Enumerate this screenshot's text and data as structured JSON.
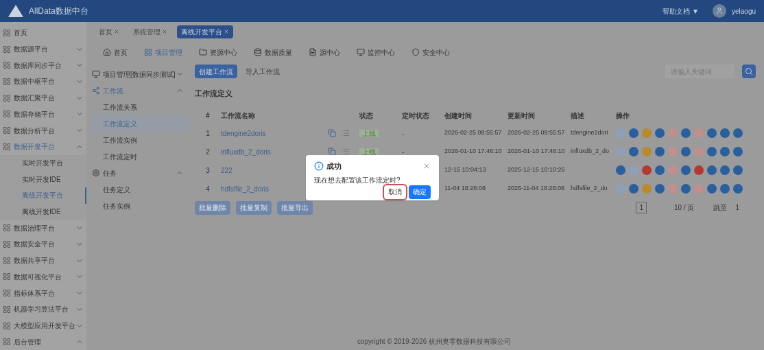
{
  "header": {
    "title": "AllData数据中台",
    "help": "帮助文档 ▼",
    "user": "yelaogu"
  },
  "sidebar": {
    "items": [
      {
        "label": "首页",
        "selected": false
      },
      {
        "label": "数据源平台",
        "expanded": false,
        "selected": false
      },
      {
        "label": "数据库同步平台",
        "expanded": false,
        "selected": false
      },
      {
        "label": "数据中枢平台",
        "expanded": false,
        "selected": false
      },
      {
        "label": "数据汇聚平台",
        "expanded": false,
        "selected": false
      },
      {
        "label": "数据存储平台",
        "expanded": false,
        "selected": false
      },
      {
        "label": "数据分析平台",
        "expanded": false,
        "selected": false
      },
      {
        "label": "数据开发平台",
        "expanded": true,
        "selected": true,
        "children": [
          {
            "label": "实时开发平台",
            "selected": false
          },
          {
            "label": "实时开发IDE",
            "selected": false
          },
          {
            "label": "离线开发平台",
            "selected": true
          },
          {
            "label": "离线开发IDE",
            "selected": false
          }
        ]
      },
      {
        "label": "数据治理平台",
        "expanded": false,
        "selected": false
      },
      {
        "label": "数据安全平台",
        "expanded": false,
        "selected": false
      },
      {
        "label": "数据共享平台",
        "expanded": false,
        "selected": false
      },
      {
        "label": "数据可视化平台",
        "expanded": false,
        "selected": false
      },
      {
        "label": "指标体系平台",
        "expanded": false,
        "selected": false
      },
      {
        "label": "机器学习算法平台",
        "expanded": false,
        "selected": false
      },
      {
        "label": "大模型应用开发平台",
        "expanded": false,
        "selected": false
      },
      {
        "label": "后台管理",
        "expanded": true,
        "selected": false
      }
    ]
  },
  "page_tabs": [
    {
      "label": "首页",
      "selected": false
    },
    {
      "label": "系统管理",
      "selected": false
    },
    {
      "label": "离线开发平台",
      "selected": true
    }
  ],
  "top_nav": [
    {
      "label": "首页",
      "selected": false
    },
    {
      "label": "项目管理",
      "selected": true
    },
    {
      "label": "资源中心",
      "selected": false
    },
    {
      "label": "数据质量",
      "selected": false
    },
    {
      "label": "源中心",
      "selected": false
    },
    {
      "label": "监控中心",
      "selected": false
    },
    {
      "label": "安全中心",
      "selected": false
    }
  ],
  "sub_menu": [
    {
      "label": "项目管理[数据同步测试]",
      "expanded": false
    },
    {
      "label": "工作流",
      "expanded": true,
      "children": [
        {
          "label": "工作流关系",
          "selected": false
        },
        {
          "label": "工作流定义",
          "selected": true
        },
        {
          "label": "工作流实例",
          "selected": false
        },
        {
          "label": "工作流定时",
          "selected": false
        }
      ]
    },
    {
      "label": "任务",
      "expanded": true,
      "children": [
        {
          "label": "任务定义",
          "selected": false
        },
        {
          "label": "任务实例",
          "selected": false
        }
      ]
    }
  ],
  "toolbar": {
    "create": "创建工作流",
    "import": "导入工作流",
    "search": {
      "placeholder": "请输入关键词"
    }
  },
  "section_title": "工作流定义",
  "table": {
    "columns": [
      "#",
      "工作流名称",
      "状态",
      "定时状态",
      "创建时间",
      "更新时间",
      "描述",
      "操作"
    ],
    "rows": [
      {
        "index": "1",
        "name": "tdengine2doris",
        "status": "上线",
        "schedule": "-",
        "created": "2026-02-25 09:55:57",
        "updated": "2026-02-25 09:55:57",
        "description": "tdengine2dori",
        "actions": [
          {
            "color": "#8ea1b9"
          },
          {
            "color": "#2a5f9e"
          },
          {
            "color": "#b98a2a"
          },
          {
            "color": "#2a5f9e"
          },
          {
            "color": "#c28f8f"
          },
          {
            "color": "#2a5f9e"
          },
          {
            "color": "#c28f8f"
          },
          {
            "color": "#2a5f9e"
          },
          {
            "color": "#2a5f9e"
          },
          {
            "color": "#2a5f9e"
          }
        ]
      },
      {
        "index": "2",
        "name": "influxdb_2_doris",
        "status": "上线",
        "schedule": "-",
        "created": "2026-01-10 17:48:10",
        "updated": "2026-01-10 17:48:10",
        "description": "influxdb_2_do",
        "actions": [
          {
            "color": "#8ea1b9"
          },
          {
            "color": "#2a5f9e"
          },
          {
            "color": "#b98a2a"
          },
          {
            "color": "#2a5f9e"
          },
          {
            "color": "#c28f8f"
          },
          {
            "color": "#2a5f9e"
          },
          {
            "color": "#c28f8f"
          },
          {
            "color": "#2a5f9e"
          },
          {
            "color": "#2a5f9e"
          },
          {
            "color": "#2a5f9e"
          }
        ]
      },
      {
        "index": "3",
        "name": "222",
        "created": "12-15 10:04:13",
        "updated": "2025-12-15 10:10:26",
        "actions": [
          {
            "color": "#2a5f9e"
          },
          {
            "color": "#8ea1b9"
          },
          {
            "color": "#b23a32"
          },
          {
            "color": "#2a5f9e"
          },
          {
            "color": "#c28f8f"
          },
          {
            "color": "#2a5f9e"
          },
          {
            "color": "#b23a32"
          },
          {
            "color": "#2a5f9e"
          },
          {
            "color": "#2a5f9e"
          },
          {
            "color": "#2a5f9e"
          }
        ]
      },
      {
        "index": "4",
        "name": "hdfsfile_2_doris",
        "created": "11-04 18:28:08",
        "updated": "2025-11-04 18:28:08",
        "description": "hdfsfile_2_do",
        "actions": [
          {
            "color": "#8ea1b9"
          },
          {
            "color": "#2a5f9e"
          },
          {
            "color": "#b98a2a"
          },
          {
            "color": "#2a5f9e"
          },
          {
            "color": "#c28f8f"
          },
          {
            "color": "#2a5f9e"
          },
          {
            "color": "#c28f8f"
          },
          {
            "color": "#2a5f9e"
          },
          {
            "color": "#2a5f9e"
          },
          {
            "color": "#2a5f9e"
          }
        ]
      }
    ]
  },
  "batch_buttons": [
    {
      "label": "批量删除",
      "disabled": true
    },
    {
      "label": "批量复制",
      "disabled": true
    },
    {
      "label": "批量导出",
      "disabled": true
    }
  ],
  "pagination": {
    "page": "1",
    "page_size": "10 / 页",
    "jump_label": "跳至",
    "jump_value": "1"
  },
  "footer": "copyright © 2019-2026 杭州奥零数据科技有限公司",
  "dialog": {
    "title": "成功",
    "message": "现在想去配置该工作流定时?",
    "buttons": [
      {
        "label": "取消",
        "kind": "default",
        "highlighted": true
      },
      {
        "label": "确定",
        "kind": "primary",
        "highlighted": false
      }
    ]
  }
}
